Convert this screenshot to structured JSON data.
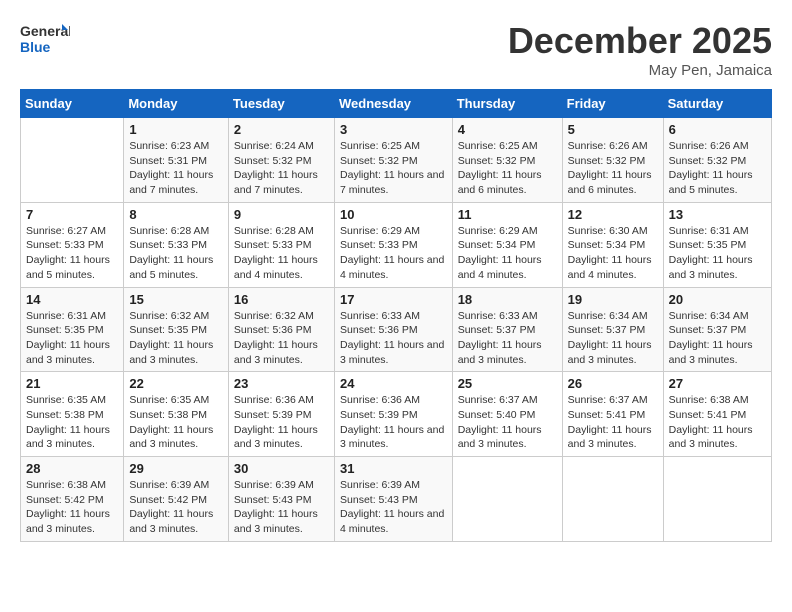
{
  "header": {
    "logo_line1": "General",
    "logo_line2": "Blue",
    "month_title": "December 2025",
    "subtitle": "May Pen, Jamaica"
  },
  "weekdays": [
    "Sunday",
    "Monday",
    "Tuesday",
    "Wednesday",
    "Thursday",
    "Friday",
    "Saturday"
  ],
  "weeks": [
    [
      {
        "day": "",
        "sunrise": "",
        "sunset": "",
        "daylight": ""
      },
      {
        "day": "1",
        "sunrise": "Sunrise: 6:23 AM",
        "sunset": "Sunset: 5:31 PM",
        "daylight": "Daylight: 11 hours and 7 minutes."
      },
      {
        "day": "2",
        "sunrise": "Sunrise: 6:24 AM",
        "sunset": "Sunset: 5:32 PM",
        "daylight": "Daylight: 11 hours and 7 minutes."
      },
      {
        "day": "3",
        "sunrise": "Sunrise: 6:25 AM",
        "sunset": "Sunset: 5:32 PM",
        "daylight": "Daylight: 11 hours and 7 minutes."
      },
      {
        "day": "4",
        "sunrise": "Sunrise: 6:25 AM",
        "sunset": "Sunset: 5:32 PM",
        "daylight": "Daylight: 11 hours and 6 minutes."
      },
      {
        "day": "5",
        "sunrise": "Sunrise: 6:26 AM",
        "sunset": "Sunset: 5:32 PM",
        "daylight": "Daylight: 11 hours and 6 minutes."
      },
      {
        "day": "6",
        "sunrise": "Sunrise: 6:26 AM",
        "sunset": "Sunset: 5:32 PM",
        "daylight": "Daylight: 11 hours and 5 minutes."
      }
    ],
    [
      {
        "day": "7",
        "sunrise": "Sunrise: 6:27 AM",
        "sunset": "Sunset: 5:33 PM",
        "daylight": "Daylight: 11 hours and 5 minutes."
      },
      {
        "day": "8",
        "sunrise": "Sunrise: 6:28 AM",
        "sunset": "Sunset: 5:33 PM",
        "daylight": "Daylight: 11 hours and 5 minutes."
      },
      {
        "day": "9",
        "sunrise": "Sunrise: 6:28 AM",
        "sunset": "Sunset: 5:33 PM",
        "daylight": "Daylight: 11 hours and 4 minutes."
      },
      {
        "day": "10",
        "sunrise": "Sunrise: 6:29 AM",
        "sunset": "Sunset: 5:33 PM",
        "daylight": "Daylight: 11 hours and 4 minutes."
      },
      {
        "day": "11",
        "sunrise": "Sunrise: 6:29 AM",
        "sunset": "Sunset: 5:34 PM",
        "daylight": "Daylight: 11 hours and 4 minutes."
      },
      {
        "day": "12",
        "sunrise": "Sunrise: 6:30 AM",
        "sunset": "Sunset: 5:34 PM",
        "daylight": "Daylight: 11 hours and 4 minutes."
      },
      {
        "day": "13",
        "sunrise": "Sunrise: 6:31 AM",
        "sunset": "Sunset: 5:35 PM",
        "daylight": "Daylight: 11 hours and 3 minutes."
      }
    ],
    [
      {
        "day": "14",
        "sunrise": "Sunrise: 6:31 AM",
        "sunset": "Sunset: 5:35 PM",
        "daylight": "Daylight: 11 hours and 3 minutes."
      },
      {
        "day": "15",
        "sunrise": "Sunrise: 6:32 AM",
        "sunset": "Sunset: 5:35 PM",
        "daylight": "Daylight: 11 hours and 3 minutes."
      },
      {
        "day": "16",
        "sunrise": "Sunrise: 6:32 AM",
        "sunset": "Sunset: 5:36 PM",
        "daylight": "Daylight: 11 hours and 3 minutes."
      },
      {
        "day": "17",
        "sunrise": "Sunrise: 6:33 AM",
        "sunset": "Sunset: 5:36 PM",
        "daylight": "Daylight: 11 hours and 3 minutes."
      },
      {
        "day": "18",
        "sunrise": "Sunrise: 6:33 AM",
        "sunset": "Sunset: 5:37 PM",
        "daylight": "Daylight: 11 hours and 3 minutes."
      },
      {
        "day": "19",
        "sunrise": "Sunrise: 6:34 AM",
        "sunset": "Sunset: 5:37 PM",
        "daylight": "Daylight: 11 hours and 3 minutes."
      },
      {
        "day": "20",
        "sunrise": "Sunrise: 6:34 AM",
        "sunset": "Sunset: 5:37 PM",
        "daylight": "Daylight: 11 hours and 3 minutes."
      }
    ],
    [
      {
        "day": "21",
        "sunrise": "Sunrise: 6:35 AM",
        "sunset": "Sunset: 5:38 PM",
        "daylight": "Daylight: 11 hours and 3 minutes."
      },
      {
        "day": "22",
        "sunrise": "Sunrise: 6:35 AM",
        "sunset": "Sunset: 5:38 PM",
        "daylight": "Daylight: 11 hours and 3 minutes."
      },
      {
        "day": "23",
        "sunrise": "Sunrise: 6:36 AM",
        "sunset": "Sunset: 5:39 PM",
        "daylight": "Daylight: 11 hours and 3 minutes."
      },
      {
        "day": "24",
        "sunrise": "Sunrise: 6:36 AM",
        "sunset": "Sunset: 5:39 PM",
        "daylight": "Daylight: 11 hours and 3 minutes."
      },
      {
        "day": "25",
        "sunrise": "Sunrise: 6:37 AM",
        "sunset": "Sunset: 5:40 PM",
        "daylight": "Daylight: 11 hours and 3 minutes."
      },
      {
        "day": "26",
        "sunrise": "Sunrise: 6:37 AM",
        "sunset": "Sunset: 5:41 PM",
        "daylight": "Daylight: 11 hours and 3 minutes."
      },
      {
        "day": "27",
        "sunrise": "Sunrise: 6:38 AM",
        "sunset": "Sunset: 5:41 PM",
        "daylight": "Daylight: 11 hours and 3 minutes."
      }
    ],
    [
      {
        "day": "28",
        "sunrise": "Sunrise: 6:38 AM",
        "sunset": "Sunset: 5:42 PM",
        "daylight": "Daylight: 11 hours and 3 minutes."
      },
      {
        "day": "29",
        "sunrise": "Sunrise: 6:39 AM",
        "sunset": "Sunset: 5:42 PM",
        "daylight": "Daylight: 11 hours and 3 minutes."
      },
      {
        "day": "30",
        "sunrise": "Sunrise: 6:39 AM",
        "sunset": "Sunset: 5:43 PM",
        "daylight": "Daylight: 11 hours and 3 minutes."
      },
      {
        "day": "31",
        "sunrise": "Sunrise: 6:39 AM",
        "sunset": "Sunset: 5:43 PM",
        "daylight": "Daylight: 11 hours and 4 minutes."
      },
      {
        "day": "",
        "sunrise": "",
        "sunset": "",
        "daylight": ""
      },
      {
        "day": "",
        "sunrise": "",
        "sunset": "",
        "daylight": ""
      },
      {
        "day": "",
        "sunrise": "",
        "sunset": "",
        "daylight": ""
      }
    ]
  ]
}
